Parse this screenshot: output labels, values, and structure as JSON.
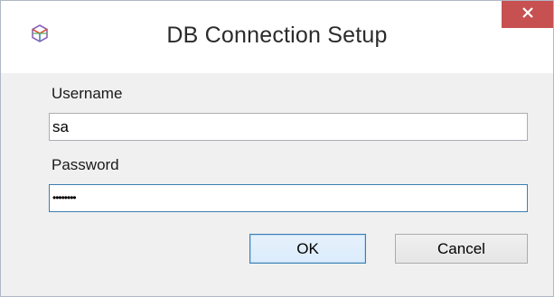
{
  "window": {
    "title": "DB Connection Setup",
    "icon": "database-cube-icon",
    "close_icon": "close-icon",
    "close_color": "#c75050"
  },
  "form": {
    "username_label": "Username",
    "username_value": "sa",
    "password_label": "Password",
    "password_value": "••••••••"
  },
  "buttons": {
    "ok_label": "OK",
    "cancel_label": "Cancel"
  }
}
